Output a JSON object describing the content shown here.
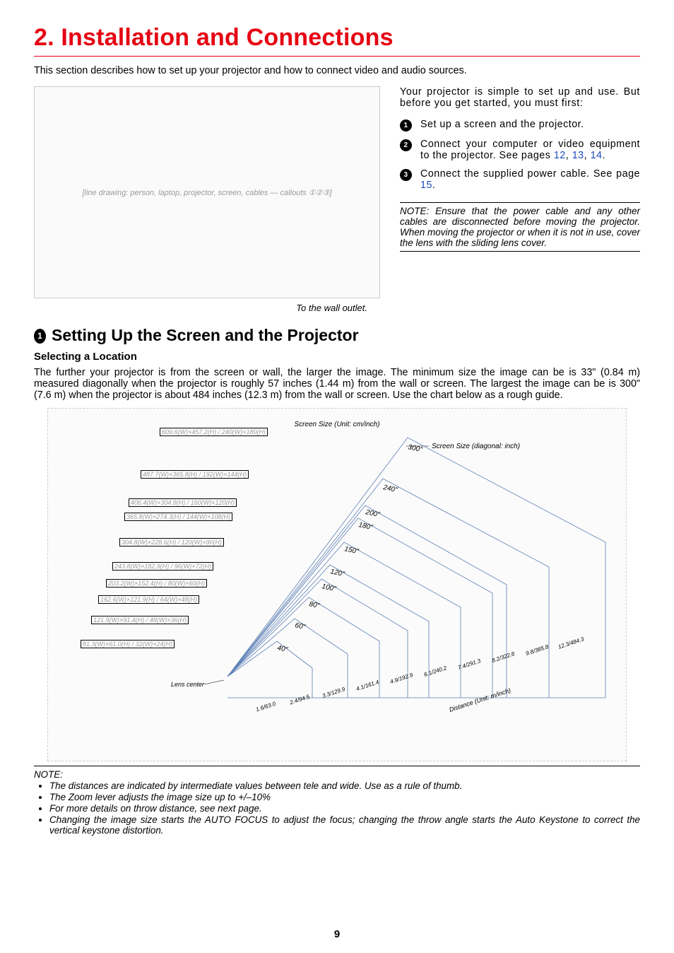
{
  "chapter_title": "2. Installation and Connections",
  "intro": "This section describes how to set up your projector and how to connect video and audio sources.",
  "illus_caption": "To the wall outlet.",
  "right_intro": "Your projector is simple to set up and use. But before you get started, you must first:",
  "steps": [
    {
      "num": "1",
      "text_a": "Set up a screen and the projector.",
      "links": []
    },
    {
      "num": "2",
      "text_a": "Connect your computer or video equipment to the projector. See pages ",
      "links": [
        "12",
        "13",
        "14"
      ],
      "tail": "."
    },
    {
      "num": "3",
      "text_a": "Connect the supplied power cable. See page ",
      "links": [
        "15"
      ],
      "tail": "."
    }
  ],
  "note1": "NOTE: Ensure that the power cable and any other cables are disconnected before moving the projector. When moving the projector or when it is not in use, cover the lens with the sliding lens cover.",
  "section_num": "1",
  "section_title": "Setting Up the Screen and the Projector",
  "subhead": "Selecting a Location",
  "body1": "The further your projector is from the screen or wall, the larger the image. The minimum size the image can be is 33\" (0.84 m) measured diagonally when the projector is roughly 57 inches (1.44 m) from the wall or screen. The largest the image can be is 300\" (7.6 m) when the projector is about 484 inches (12.3 m) from the wall or screen. Use the chart below as a rough guide.",
  "chart_data": {
    "type": "diagram",
    "title_top": "Screen Size (Unit: cm/inch)",
    "title_right": "Screen Size (diagonal: inch)",
    "distance_axis_label": "Distance (Unit: m/inch)",
    "lens_label": "Lens center",
    "screen_sizes": [
      {
        "dims": "609.6(W)×457.2(H) / 240(W)×180(H)",
        "diag": "300\""
      },
      {
        "dims": "487.7(W)×365.8(H) / 192(W)×144(H)",
        "diag": "240\""
      },
      {
        "dims": "406.4(W)×304.8(H) / 160(W)×120(H)",
        "diag": "200\""
      },
      {
        "dims": "365.8(W)×274.3(H) / 144(W)×108(H)",
        "diag": "180\""
      },
      {
        "dims": "304.8(W)×228.6(H) / 120(W)×90(H)",
        "diag": "150\""
      },
      {
        "dims": "243.8(W)×182.9(H) / 96(W)×72(H)",
        "diag": "120\""
      },
      {
        "dims": "203.2(W)×152.4(H) / 80(W)×60(H)",
        "diag": "100\""
      },
      {
        "dims": "162.6(W)×121.9(H) / 64(W)×48(H)",
        "diag": "80\""
      },
      {
        "dims": "121.9(W)×91.4(H) / 48(W)×36(H)",
        "diag": "60\""
      },
      {
        "dims": "81.3(W)×61.0(H) / 32(W)×24(H)",
        "diag": "40\""
      }
    ],
    "distances": [
      "1.6/63.0",
      "2.4/94.5",
      "3.3/129.9",
      "4.1/161.4",
      "4.9/192.9",
      "6.1/240.2",
      "7.4/291.3",
      "8.2/322.8",
      "9.8/385.8",
      "12.3/484.3"
    ]
  },
  "notes2_head": "NOTE:",
  "notes2": [
    "The distances are indicated by intermediate values between tele and wide. Use as a rule of thumb.",
    "The Zoom lever adjusts the image size up to +/–10%",
    "For more details on throw distance, see next page.",
    "Changing the image size starts the AUTO FOCUS to adjust the focus; changing the throw angle starts the Auto Keystone to correct the vertical keystone distortion."
  ],
  "page_number": "9",
  "illus_alt": "[line drawing: person, laptop, projector, screen, cables — callouts ①②③]",
  "figure2_alt": "[isometric throw-distance diagram — see chart_data]"
}
